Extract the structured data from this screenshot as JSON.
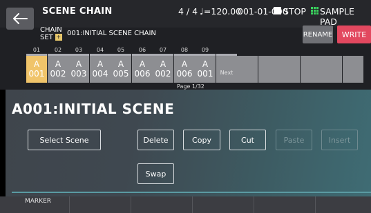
{
  "header": {
    "title": "SCENE CHAIN",
    "beat": "4 / 4",
    "tempo": "♩=120.00",
    "position": "001-01-000",
    "transport": "STOP",
    "mode": "SAMPLE PAD"
  },
  "chain": {
    "set_label_line1": "CHAIN",
    "set_label_line2": "SET",
    "set_icon": "plus-icon",
    "name": "001:INITIAL SCENE CHAIN",
    "rename_label": "RENAME",
    "write_label": "WRITE"
  },
  "steps": [
    {
      "num": "01",
      "bank": "A",
      "scene": "001",
      "active": true
    },
    {
      "num": "02",
      "bank": "A",
      "scene": "002"
    },
    {
      "num": "03",
      "bank": "A",
      "scene": "003"
    },
    {
      "num": "04",
      "bank": "A",
      "scene": "004"
    },
    {
      "num": "05",
      "bank": "A",
      "scene": "005"
    },
    {
      "num": "06",
      "bank": "A",
      "scene": "006"
    },
    {
      "num": "07",
      "bank": "A",
      "scene": "002"
    },
    {
      "num": "08",
      "bank": "A",
      "scene": "006"
    },
    {
      "num": "09",
      "bank": "A",
      "scene": "001"
    }
  ],
  "next_label": "Next",
  "page": "Page 1/32",
  "scene_title": "A001:INITIAL SCENE",
  "buttons": {
    "select_scene": "Select Scene",
    "delete": "Delete",
    "copy": "Copy",
    "cut": "Cut",
    "paste": "Paste",
    "insert": "Insert",
    "swap": "Swap"
  },
  "footer": {
    "marker": "MARKER"
  },
  "colors": {
    "active_step": "#f0c46a",
    "write": "#e2485f",
    "sample_pad_icon": "#3ad35e"
  }
}
